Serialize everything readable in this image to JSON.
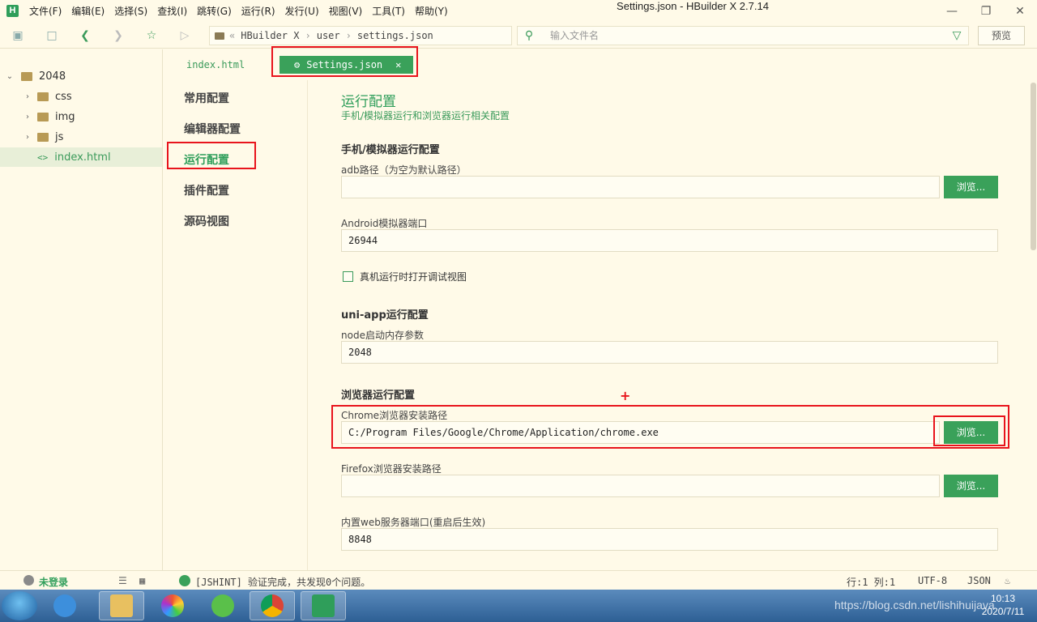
{
  "app": {
    "logo": "H",
    "title": "Settings.json - HBuilder X 2.7.14",
    "menu": [
      "文件(F)",
      "编辑(E)",
      "选择(S)",
      "查找(I)",
      "跳转(G)",
      "运行(R)",
      "发行(U)",
      "视图(V)",
      "工具(T)",
      "帮助(Y)"
    ]
  },
  "toolbar": {
    "breadcrumb": [
      "HBuilder X",
      "user",
      "settings.json"
    ],
    "search_placeholder": "输入文件名",
    "preview_label": "预览"
  },
  "sidebar": {
    "project": "2048",
    "items": [
      {
        "label": "css",
        "icon": "folder-icon"
      },
      {
        "label": "img",
        "icon": "folder-icon"
      },
      {
        "label": "js",
        "icon": "folder-icon"
      },
      {
        "label": "index.html",
        "icon": "code-icon"
      }
    ]
  },
  "tabs": {
    "inactive": "index.html",
    "active": "Settings.json"
  },
  "settings_nav": [
    "常用配置",
    "编辑器配置",
    "运行配置",
    "插件配置",
    "源码视图"
  ],
  "content": {
    "title": "运行配置",
    "subtitle": "手机/模拟器运行和浏览器运行相关配置",
    "mobile_section": "手机/模拟器运行配置",
    "adb_label": "adb路径（为空为默认路径）",
    "adb_value": "",
    "android_port_label": "Android模拟器端口",
    "android_port_value": "26944",
    "devtools_checkbox": "真机运行时打开调试视图",
    "uniapp_section": "uni-app运行配置",
    "node_label": "node启动内存参数",
    "node_value": "2048",
    "browser_section": "浏览器运行配置",
    "chrome_label": "Chrome浏览器安装路径",
    "chrome_value": "C:/Program Files/Google/Chrome/Application/chrome.exe",
    "firefox_label": "Firefox浏览器安装路径",
    "firefox_value": "",
    "webserver_label": "内置web服务器端口(重启后生效)",
    "webserver_value": "8848",
    "browse_label": "浏览..."
  },
  "statusbar": {
    "login": "未登录",
    "message": "[JSHINT] 验证完成，共发现0个问题。",
    "position": "行:1  列:1",
    "encoding": "UTF-8",
    "language": "JSON"
  },
  "taskbar": {
    "time": "10:13",
    "date": "2020/7/11",
    "watermark": "https://blog.csdn.net/lishihuijava"
  },
  "colors": {
    "accent": "#3aa15a",
    "background": "#fffae8",
    "annotation": "#e8141c"
  }
}
